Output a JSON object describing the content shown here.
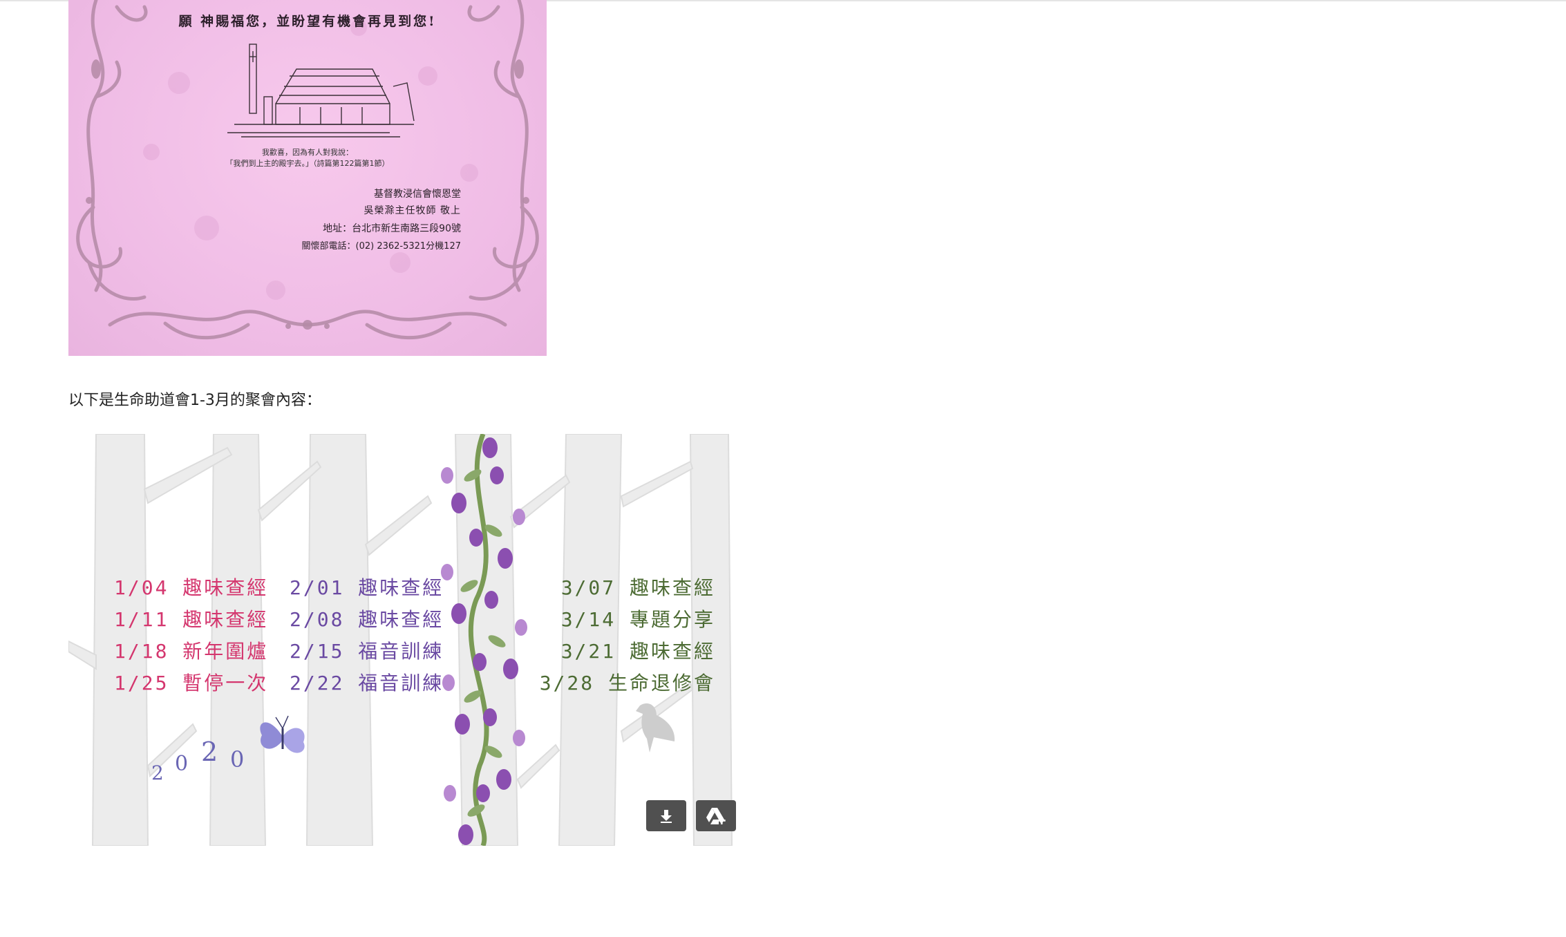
{
  "card": {
    "greeting": "願  神賜福您，並盼望有機會再見到您!",
    "verse_line1": "我歡喜，因為有人對我說：",
    "verse_line2": "「我們到上主的殿宇去。」（詩篇第122篇第1節）",
    "church": "基督教浸信會懷恩堂",
    "pastor": "吳榮滁主任牧師  敬上",
    "address": "地址：台北市新生南路三段90號",
    "phone": "關懷部電話：(02) 2362-5321分機127"
  },
  "intro_text": "以下是生命助道會1-3月的聚會內容：",
  "schedule": {
    "january": [
      "1/04 趣味查經",
      "1/11 趣味查經",
      "1/18 新年圍爐",
      "1/25 暫停一次"
    ],
    "february": [
      "2/01 趣味查經",
      "2/08 趣味查經",
      "2/15 福音訓練",
      "2/22 福音訓練"
    ],
    "march": [
      "3/07 趣味查經",
      "3/14 專題分享",
      "3/21 趣味查經",
      "3/28 生命退修會"
    ],
    "year_digits": [
      "2",
      "0",
      "2",
      "0"
    ]
  },
  "buttons": {
    "download_icon": "download-icon",
    "drive_icon": "google-drive-add-icon"
  },
  "colors": {
    "card_pink": "#f0bde6",
    "january_text": "#d4366e",
    "february_text": "#6a49a2",
    "march_text": "#4c6b33",
    "button_bg": "#505050"
  }
}
